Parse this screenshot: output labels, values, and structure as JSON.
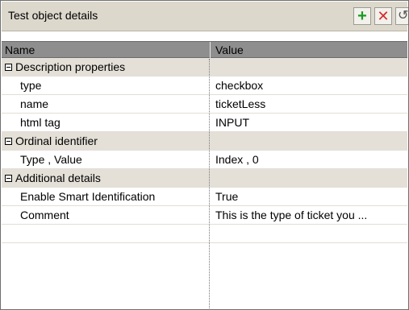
{
  "panel": {
    "title": "Test object details",
    "buttons": [
      {
        "id": "add",
        "icon": "plus-icon",
        "glyph": "+",
        "color": "#1a9a22"
      },
      {
        "id": "delete",
        "icon": "close-icon",
        "glyph": "✕",
        "color": "#d82a2a"
      },
      {
        "id": "undo",
        "icon": "undo-icon",
        "glyph": "↺"
      }
    ]
  },
  "grid": {
    "columns": [
      "Name",
      "Value"
    ],
    "rows": [
      {
        "type": "group",
        "name": "Description properties",
        "value": ""
      },
      {
        "type": "item",
        "name": "type",
        "value": "checkbox"
      },
      {
        "type": "item",
        "name": "name",
        "value": "ticketLess"
      },
      {
        "type": "item",
        "name": "html tag",
        "value": "INPUT"
      },
      {
        "type": "group",
        "name": "Ordinal identifier",
        "value": ""
      },
      {
        "type": "item",
        "name": "Type , Value",
        "value": "Index , 0"
      },
      {
        "type": "group",
        "name": "Additional details",
        "value": ""
      },
      {
        "type": "item",
        "name": "Enable Smart Identification",
        "value": "True"
      },
      {
        "type": "item",
        "name": "Comment",
        "value": "This is the type of ticket you ..."
      },
      {
        "type": "item",
        "name": "",
        "value": ""
      }
    ]
  }
}
